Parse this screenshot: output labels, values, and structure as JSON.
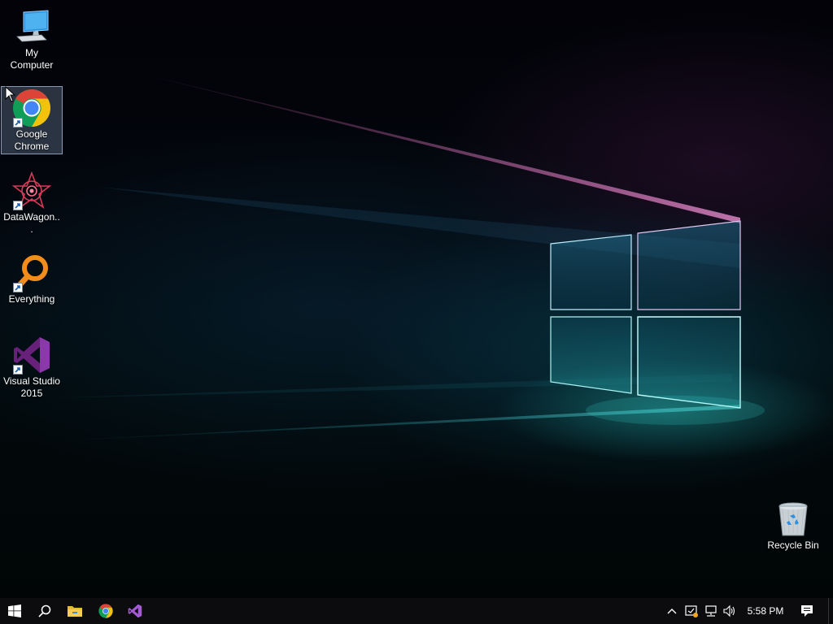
{
  "desktop": {
    "icons": [
      {
        "name": "desktop-icon-my-computer",
        "label": "My Computer",
        "icon": "computer-icon",
        "shortcut": false,
        "selected": false
      },
      {
        "name": "desktop-icon-google-chrome",
        "label": "Google Chrome",
        "icon": "chrome-icon",
        "shortcut": true,
        "selected": true
      },
      {
        "name": "desktop-icon-datawagon",
        "label": "DataWagon...",
        "icon": "datawagon-icon",
        "shortcut": true,
        "selected": false
      },
      {
        "name": "desktop-icon-everything",
        "label": "Everything",
        "icon": "everything-search-icon",
        "shortcut": true,
        "selected": false
      },
      {
        "name": "desktop-icon-visual-studio",
        "label": "Visual Studio 2015",
        "icon": "visual-studio-icon",
        "shortcut": true,
        "selected": false
      },
      {
        "name": "desktop-icon-recycle-bin",
        "label": "Recycle Bin",
        "icon": "recycle-bin-icon",
        "shortcut": false,
        "selected": false
      }
    ]
  },
  "taskbar": {
    "buttons": [
      {
        "name": "start-button",
        "icon": "windows-logo-icon"
      },
      {
        "name": "search-button",
        "icon": "search-icon"
      },
      {
        "name": "file-explorer-button",
        "icon": "folder-icon"
      },
      {
        "name": "chrome-taskbar-button",
        "icon": "chrome-icon"
      },
      {
        "name": "visual-studio-taskbar-button",
        "icon": "visual-studio-icon"
      }
    ],
    "tray": {
      "icons": [
        "chevron-up-icon",
        "security-shield-icon",
        "network-icon",
        "volume-icon"
      ],
      "time": "5:58 PM",
      "notification_icon": "action-center-icon"
    }
  },
  "colors": {
    "taskbar": "#0c0c0e",
    "chrome_red": "#db4437",
    "chrome_yellow": "#f4c20d",
    "chrome_green": "#0f9d58",
    "chrome_blue": "#4285f4",
    "vs_purple": "#68217a",
    "everything_orange": "#f28c1a",
    "window_glow": "#5ff0f0"
  }
}
